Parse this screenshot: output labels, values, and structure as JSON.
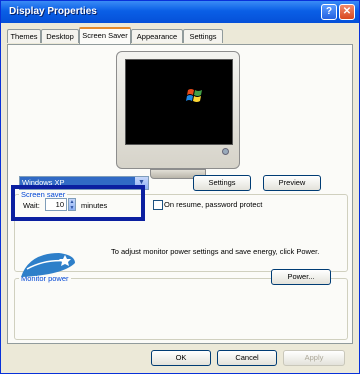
{
  "window": {
    "title": "Display Properties"
  },
  "title_buttons": {
    "help": "?",
    "close": "✕"
  },
  "tabs": [
    {
      "label": "Themes"
    },
    {
      "label": "Desktop"
    },
    {
      "label": "Screen Saver"
    },
    {
      "label": "Appearance"
    },
    {
      "label": "Settings"
    }
  ],
  "screen_saver": {
    "legend": "Screen saver",
    "selected": "Windows XP",
    "settings_label": "Settings",
    "preview_label": "Preview",
    "wait_label": "Wait:",
    "wait_value": "10",
    "minutes_label": "minutes",
    "password_label": "On resume, password protect"
  },
  "monitor_power": {
    "legend": "Monitor power",
    "description": "To adjust monitor power settings and save energy, click Power.",
    "power_label": "Power..."
  },
  "dialog": {
    "ok": "OK",
    "cancel": "Cancel",
    "apply": "Apply"
  },
  "colors": {
    "accent": "#0b1fa0",
    "titlebar": "#0a5fe6",
    "selection": "#316ac5"
  }
}
